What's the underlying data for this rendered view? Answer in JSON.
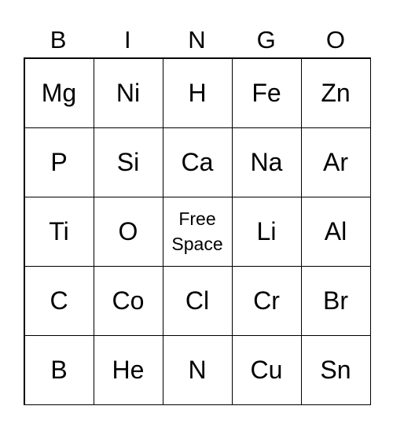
{
  "header": [
    "B",
    "I",
    "N",
    "G",
    "O"
  ],
  "cells": [
    [
      "Mg",
      "Ni",
      "H",
      "Fe",
      "Zn"
    ],
    [
      "P",
      "Si",
      "Ca",
      "Na",
      "Ar"
    ],
    [
      "Ti",
      "O",
      "Free Space",
      "Li",
      "Al"
    ],
    [
      "C",
      "Co",
      "Cl",
      "Cr",
      "Br"
    ],
    [
      "B",
      "He",
      "N",
      "Cu",
      "Sn"
    ]
  ]
}
